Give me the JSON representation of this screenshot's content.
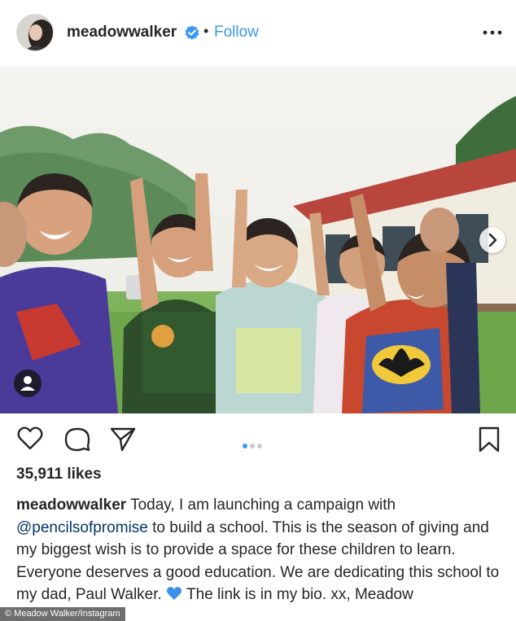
{
  "post": {
    "username": "meadowwalker",
    "separator": "•",
    "follow_label": "Follow",
    "likes": "35,911 likes",
    "caption": {
      "username": "meadowwalker",
      "text_1": " Today, I am launching a campaign with ",
      "mention": "@pencilsofpromise",
      "text_2": " to build a school. This is the season of giving and my biggest wish is to provide a space for these children to learn. Everyone deserves a good education. We are dedicating this school to my dad, Paul Walker. ",
      "text_3": " The link is in my bio. xx, Meadow"
    },
    "carousel": {
      "total": 3,
      "active_index": 0
    }
  },
  "icons": {
    "verified": "verified-badge-icon",
    "more": "more-options-icon",
    "next": "chevron-right-icon",
    "tag": "user-tag-icon",
    "like": "heart-outline-icon",
    "comment": "comment-icon",
    "share": "paper-plane-icon",
    "save": "bookmark-icon",
    "emoji": "blue-heart-emoji"
  },
  "colors": {
    "link": "#3897f0",
    "verified": "#3897f0",
    "text": "#262626",
    "emoji_heart": "#3d8fe5"
  },
  "credit": "© Meadow Walker/Instagram"
}
